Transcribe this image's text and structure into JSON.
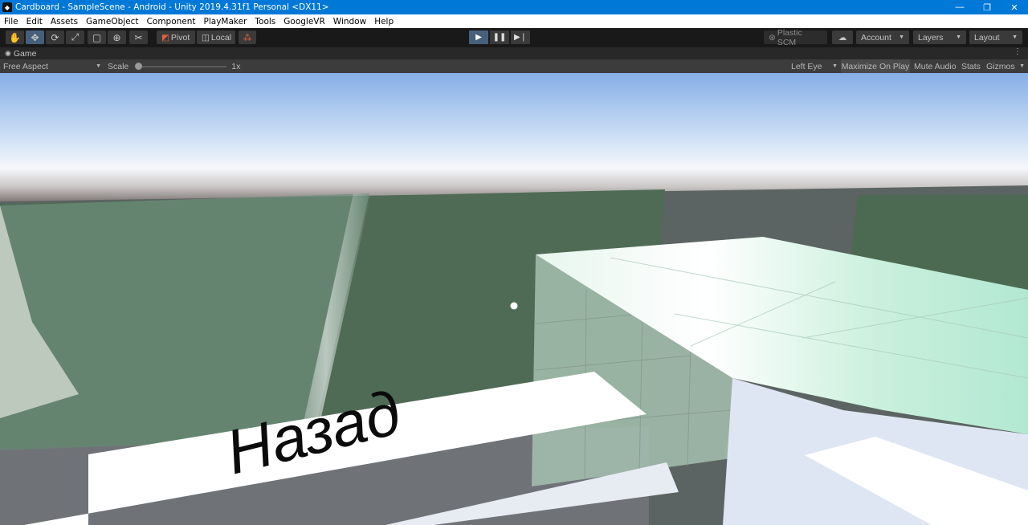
{
  "window": {
    "title": "Cardboard - SampleScene - Android - Unity 2019.4.31f1 Personal <DX11>",
    "minimize_glyph": "—",
    "restore_glyph": "❐",
    "close_glyph": "✕"
  },
  "menu": [
    "File",
    "Edit",
    "Assets",
    "GameObject",
    "Component",
    "PlayMaker",
    "Tools",
    "GoogleVR",
    "Window",
    "Help"
  ],
  "toolbar": {
    "tools": [
      "hand-icon",
      "move-icon",
      "rotate-icon",
      "scale-icon",
      "rect-icon",
      "transform-icon",
      "custom-tool-icon"
    ],
    "pivot_label": "Pivot",
    "local_label": "Local",
    "plastic_label": "Plastic SCM",
    "account_label": "Account",
    "layers_label": "Layers",
    "layout_label": "Layout"
  },
  "game_tab": {
    "tab_label": "Game",
    "aspect_label": "Free Aspect",
    "scale_label": "Scale",
    "scale_value": "1x",
    "eye_label": "Left Eye",
    "maximize_label": "Maximize On Play",
    "mute_label": "Mute Audio",
    "stats_label": "Stats",
    "gizmos_label": "Gizmos"
  },
  "scene": {
    "button_text": "Назад"
  },
  "colors": {
    "title_bar": "#0078d7",
    "active_tool": "#46607c",
    "sky_top": "#8bb4e8",
    "wall_green": "#4f6b55"
  }
}
